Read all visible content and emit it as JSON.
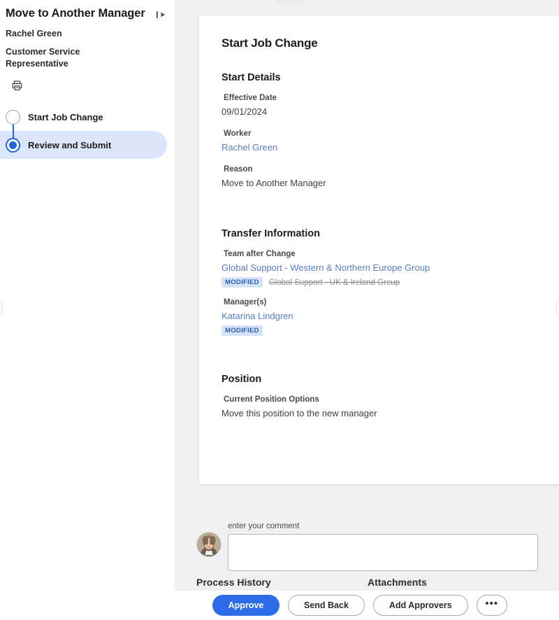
{
  "sidebar": {
    "title": "Move to Another Manager",
    "collapse_icon": "collapse-panel-icon",
    "worker_name": "Rachel Green",
    "job_title": "Customer Service Representative",
    "print_icon": "printer-icon",
    "steps": [
      {
        "label": "Start Job Change",
        "state": "pending"
      },
      {
        "label": "Review and Submit",
        "state": "current"
      }
    ]
  },
  "card": {
    "title": "Start Job Change",
    "sections": [
      {
        "heading": "Start Details",
        "fields": [
          {
            "label": "Effective Date",
            "value": "09/01/2024",
            "link": false
          },
          {
            "label": "Worker",
            "value": "Rachel Green",
            "link": true
          },
          {
            "label": "Reason",
            "value": "Move to Another Manager",
            "link": false
          }
        ]
      },
      {
        "heading": "Transfer Information",
        "fields": [
          {
            "label": "Team after Change",
            "value": "Global Support - Western & Northern Europe Group",
            "link": true,
            "badge": "MODIFIED",
            "previous_value": "Global Support - UK & Ireland Group"
          },
          {
            "label": "Manager(s)",
            "value": "Katarina Lindgren",
            "link": true,
            "badge": "MODIFIED",
            "previous_value": ""
          }
        ]
      },
      {
        "heading": "Position",
        "fields": [
          {
            "label": "Current Position Options",
            "value": "Move this position to the new manager",
            "link": false
          }
        ]
      }
    ]
  },
  "comment": {
    "label": "enter your comment",
    "value": "",
    "placeholder": "",
    "avatar_name": "user-avatar"
  },
  "lower_sections": {
    "process_history": "Process History",
    "attachments": "Attachments"
  },
  "actions": {
    "approve": "Approve",
    "send_back": "Send Back",
    "add_approvers": "Add Approvers",
    "more": "•••"
  },
  "colors": {
    "accent": "#2c6ce6",
    "badge_bg": "#d5e3f7",
    "badge_text": "#2b5fb5",
    "link": "#5b7bc4",
    "active_step_bg": "#dbe6fa"
  }
}
